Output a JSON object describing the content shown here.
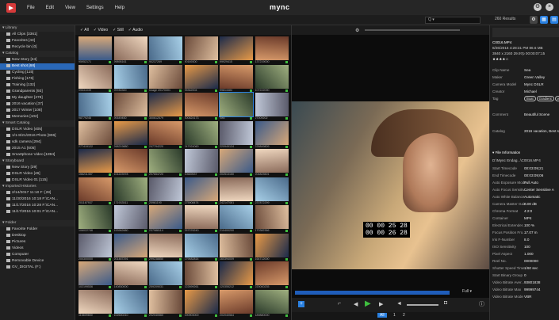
{
  "menubar": {
    "menus": [
      "File",
      "Edit",
      "View",
      "Settings",
      "Help"
    ],
    "brand": "mync"
  },
  "toolbar": {
    "search_placeholder": "Q ▾",
    "results": "260 Results"
  },
  "sidebar": {
    "library_header": "Library",
    "library": [
      "All Clips [3361]",
      "Favorites [43]",
      "Recycle bin [0]"
    ],
    "catalog_header": "Catalog",
    "catalog": [
      "New Story [24]",
      "Best shot [68]",
      "Cycling [115]",
      "Fishing [176]",
      "Training [132]",
      "Grandparents [93]",
      "My daughter [278]",
      "2016 vacation [37]",
      "2017 Winter [108]",
      "Memories [102]"
    ],
    "smart_header": "Smart Catalog",
    "smart": [
      "DSLR Video [405]",
      "1/1-8/21/2016 Photo [906]",
      "sdk camera [294]",
      "2015 A1 [605]",
      "Smartphone Video [1894]"
    ],
    "story_header": "Storyboard",
    "story": [
      "New Story [39]",
      "DSLR Video [46]",
      "DSLR Video 01 [115]"
    ],
    "imported_header": "Imported Histories",
    "imported": [
      "2/14/2017 11:10 F: [28]",
      "11/30/2016 10:18 F:\\CAN...",
      "11/17/2016 10:28 F:\\CAN...",
      "11/17/2016 10:01 F:\\CAN..."
    ],
    "folder_header": "Folder",
    "folders": [
      "Favorite Folder",
      "Desktop",
      "Pictures",
      "Videos"
    ],
    "computer": "Computer",
    "removable": "Removable Device",
    "device": "GV_DIGITAL (F:)"
  },
  "filters": [
    "All",
    "Video",
    "Still",
    "Audio"
  ],
  "thumbs": [
    "95952171",
    "99895161",
    "90237269",
    "90169300",
    "99929415",
    "137219000",
    "99531039",
    "99780300",
    "Image 20170301",
    "95362004",
    "99814484",
    "107222090",
    "98779246",
    "90649450",
    "300612579",
    "300824173",
    "Sea",
    "27009202",
    "277419122",
    "268219880",
    "247794220",
    "247924060",
    "220949124",
    "226849809",
    "156211457",
    "101223978",
    "207654720",
    "20669537",
    "202513150",
    "204823501",
    "201167937",
    "171933511",
    "20961190",
    "175908474",
    "24214T081",
    "237872299",
    "106022746",
    "153962680",
    "237988114",
    "257376240",
    "210400200",
    "170382366",
    "200300000",
    "201487291",
    "299238850",
    "179482814",
    "160394009",
    "164712000",
    "102199536",
    "140830000",
    "259209031",
    "122899261",
    "120355212",
    "220000235",
    "116609800",
    "102600210",
    "202040560",
    "190903000",
    "202040564",
    "189880000"
  ],
  "preview": {
    "timecode": "00 00 25 28",
    "timecode2": "00 00 26 28",
    "pages": [
      "All",
      "1",
      "2"
    ]
  },
  "info": {
    "filename": "C0016.MP4",
    "date": "8/26/2016 4:28:31 PM",
    "size": "86.6 MB",
    "res": "3840 x 2160 29.97p",
    "duration": "00:00:07:15",
    "rating": "★★★★☆",
    "fields": [
      [
        "Clip Name",
        "Sea"
      ],
      [
        "Maker",
        "Green Valley"
      ],
      [
        "Camera Model",
        "Mync DSLR"
      ],
      [
        "Creator",
        "Michael"
      ]
    ],
    "tag_label": "Tag",
    "tags": [
      "Boat",
      "Gradient",
      "water"
    ],
    "comment_label": "Comment",
    "comment": "Beautiful Scene",
    "catalog_label": "Catalog",
    "catalog": "2016 vacation, Best shot, New Story",
    "file_info_header": "File Information",
    "path": "D:\\Mync Endag...\\C0016.MP4",
    "file_fields": [
      [
        "Start Timecode",
        "00:03:09;21"
      ],
      [
        "End Timecode",
        "00:03:09;06"
      ],
      [
        "Auto Exposure Mode",
        "Full Auto"
      ],
      [
        "Auto Focus Sensitiv...",
        "Center Sensitive A"
      ],
      [
        "Auto White Balance",
        "Automatic"
      ],
      [
        "Camera Master Gain",
        "0.00 dB"
      ],
      [
        "Chroma Format",
        "4:2:0"
      ],
      [
        "Container",
        "MP4"
      ],
      [
        "Electrical Extender...",
        "100 %"
      ],
      [
        "Focus Position Fro...",
        "17.07 m"
      ],
      [
        "Iris F-Number",
        "8.0"
      ],
      [
        "ISO Sensitivity",
        "100"
      ],
      [
        "Pixel Aspect",
        "1.000"
      ],
      [
        "Reel No.",
        "0000000"
      ],
      [
        "Shutter Speed Time",
        "1/60 sec"
      ],
      [
        "Start Binary Group",
        "0"
      ],
      [
        "Video Bitrate Aver...",
        "93801838"
      ],
      [
        "Video Bitrate Max",
        "99999744"
      ],
      [
        "Video Bitrate Mode",
        "VBR"
      ]
    ]
  }
}
